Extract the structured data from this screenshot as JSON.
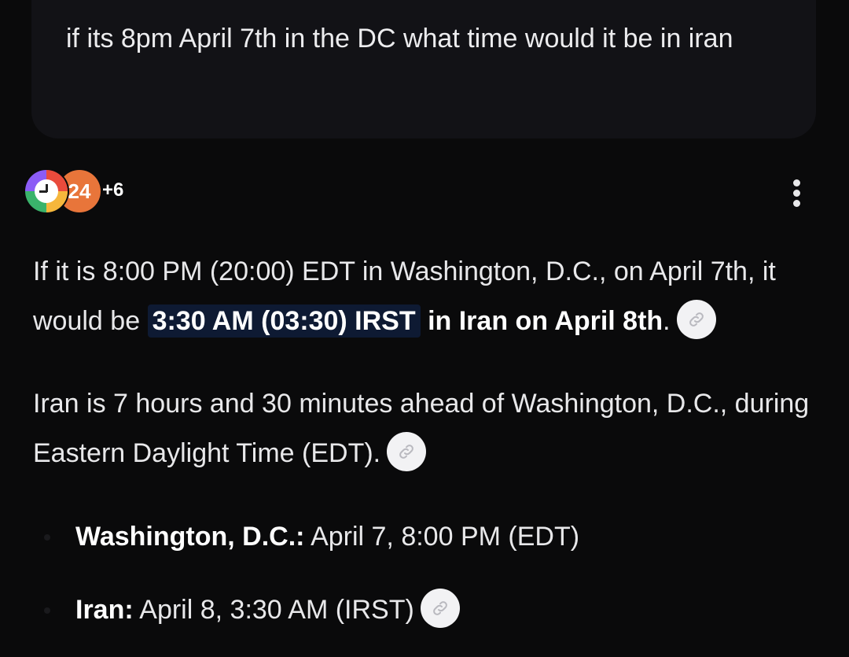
{
  "user_message": {
    "text": "if its 8pm April 7th in the DC what time would it be in iran"
  },
  "sources": {
    "icon_1": "clock-source-icon",
    "icon_2_label": "24",
    "more_count": "+6"
  },
  "menu": {
    "icon": "more-vertical-icon"
  },
  "answer": {
    "p1_prefix": "If it is 8:00 PM (20:00) EDT in Washington, D.C., on April 7th, it would be",
    "p1_highlight": "3:30 AM (03:30) IRST",
    "p1_bold": "in Iran on April 8th",
    "p1_end": ".",
    "p2_text": "Iran is 7 hours and 30 minutes ahead of Washington, D.C., during Eastern Daylight Time (EDT).",
    "bullets": [
      {
        "label": "Washington, D.C.:",
        "value": "April 7, 8:00 PM (EDT)"
      },
      {
        "label": "Iran:",
        "value": "April 8, 3:30 AM (IRST)"
      }
    ]
  },
  "colors": {
    "background": "#0a0a0b",
    "user_bubble": "#121216",
    "highlight_bg": "#0e1a33",
    "source_orange": "#e8753a"
  }
}
